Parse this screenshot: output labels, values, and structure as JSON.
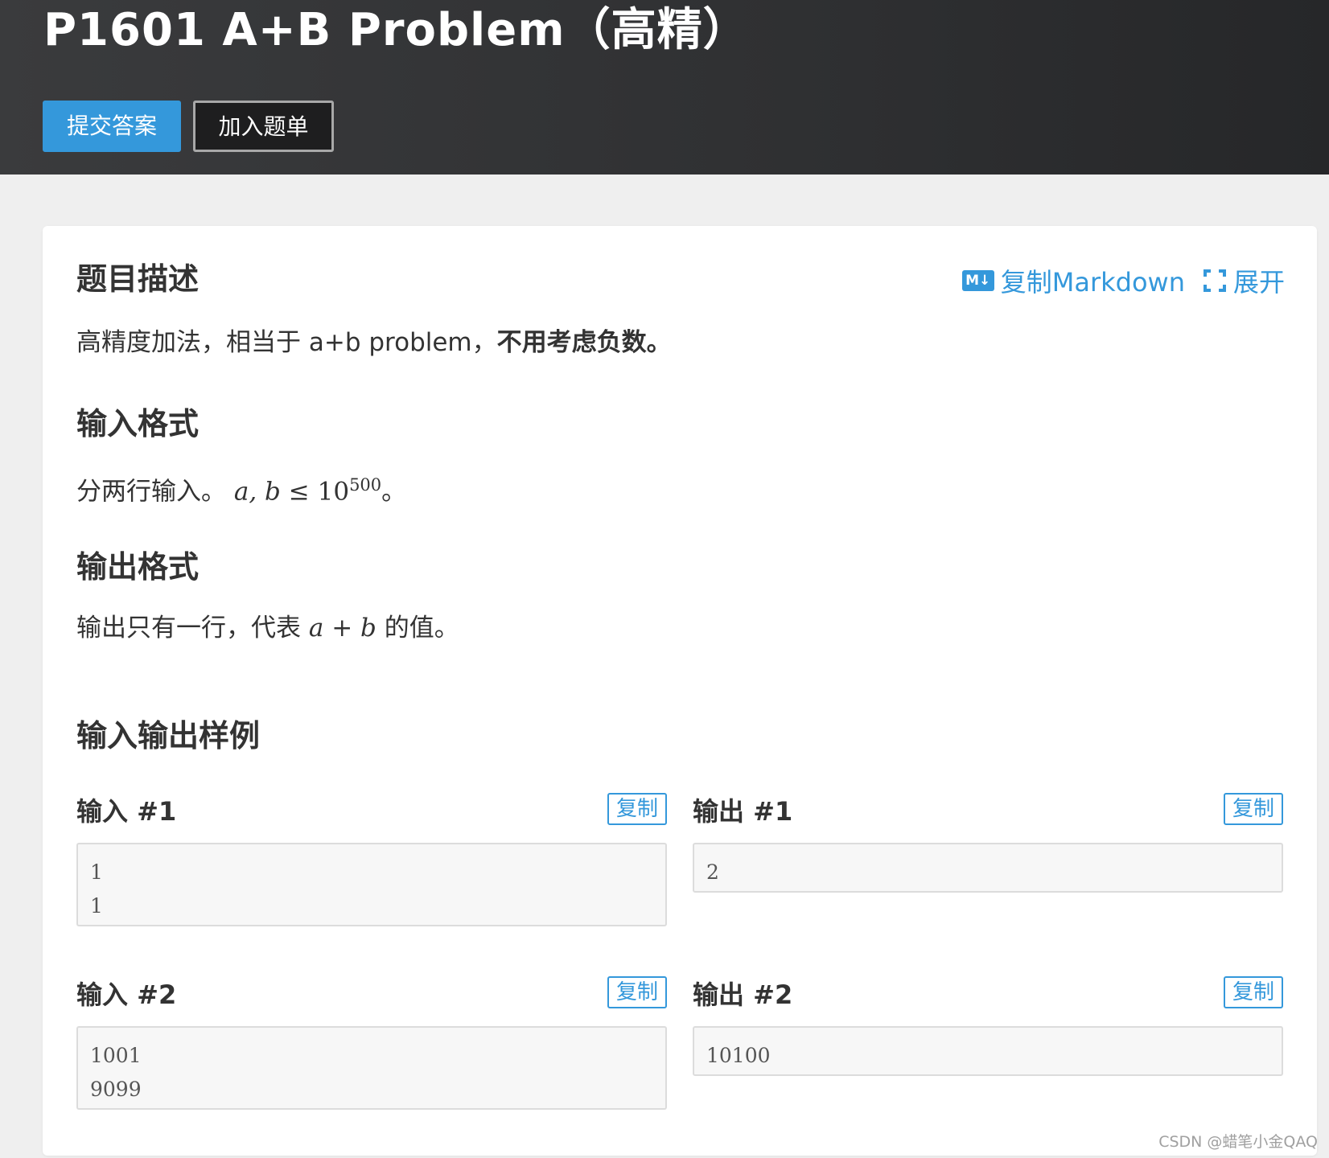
{
  "header": {
    "title": "P1601 A+B Problem（高精）",
    "submit_label": "提交答案",
    "add_label": "加入题单"
  },
  "toolbar": {
    "md_badge": "M↓",
    "copy_markdown_label": "复制Markdown",
    "expand_label": "展开"
  },
  "description": {
    "heading": "题目描述",
    "text_plain": "高精度加法，相当于 a+b problem，",
    "text_bold": "不用考虑负数。"
  },
  "input_format": {
    "heading": "输入格式",
    "text_prefix": "分两行输入。",
    "math_vars": "a, b",
    "math_op": "≤",
    "math_base": "10",
    "math_exp": "500",
    "text_suffix": "。"
  },
  "output_format": {
    "heading": "输出格式",
    "text_prefix": "输出只有一行，代表",
    "math_expr_a": "a",
    "math_plus": "+",
    "math_expr_b": "b",
    "text_suffix": "的值。"
  },
  "samples": {
    "heading": "输入输出样例",
    "copy_label": "复制",
    "items": [
      {
        "input_label": "输入 #1",
        "output_label": "输出 #1",
        "input_lines": [
          "1",
          "1"
        ],
        "output_lines": [
          "2"
        ]
      },
      {
        "input_label": "输入 #2",
        "output_label": "输出 #2",
        "input_lines": [
          "1001",
          "9099"
        ],
        "output_lines": [
          "10100"
        ]
      }
    ]
  },
  "watermark": "CSDN @蜡笔小金QAQ"
}
